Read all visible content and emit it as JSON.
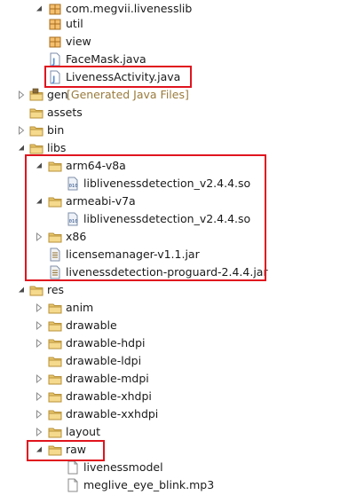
{
  "colors": {
    "highlight": "#e0141e",
    "decoration": "#9a7b3c",
    "folder": "#e8c66c",
    "java_file": "#5b8fd8"
  },
  "rows": [
    {
      "name": "tree-item-com-megvii-livenesslib",
      "label": "com.megvii.livenesslib",
      "arrow": "expanded",
      "icon": "package-icon",
      "interactable": true
    },
    {
      "name": "tree-item-util",
      "label": "util",
      "arrow": "collapsed",
      "icon": "package-icon",
      "interactable": true
    },
    {
      "name": "tree-item-view",
      "label": "view",
      "arrow": "collapsed",
      "icon": "package-icon",
      "interactable": true
    },
    {
      "name": "tree-item-facemask-java",
      "label": "FaceMask.java",
      "arrow": "collapsed",
      "icon": "java-file-icon",
      "interactable": true
    },
    {
      "name": "tree-item-livenessactivity-java",
      "label": "LivenessActivity.java",
      "arrow": "collapsed",
      "icon": "java-file-icon",
      "interactable": true
    },
    {
      "name": "tree-item-gen",
      "label": "gen",
      "decoration": "[Generated Java Files]",
      "arrow": "collapsed",
      "icon": "source-folder-icon",
      "interactable": true
    },
    {
      "name": "tree-item-assets",
      "label": "assets",
      "arrow": "none",
      "icon": "folder-icon",
      "interactable": true
    },
    {
      "name": "tree-item-bin",
      "label": "bin",
      "arrow": "collapsed",
      "icon": "folder-icon",
      "interactable": true
    },
    {
      "name": "tree-item-libs",
      "label": "libs",
      "arrow": "expanded",
      "icon": "folder-icon",
      "interactable": true
    },
    {
      "name": "tree-item-arm64-v8a",
      "label": "arm64-v8a",
      "arrow": "expanded",
      "icon": "folder-icon",
      "interactable": true
    },
    {
      "name": "tree-item-so-arm64",
      "label": "libliveness­detection_v2.4.4.so",
      "arrow": "none",
      "icon": "binary-file-icon",
      "interactable": true
    },
    {
      "name": "tree-item-armeabi-v7a",
      "label": "armeabi-v7a",
      "arrow": "expanded",
      "icon": "folder-icon",
      "interactable": true
    },
    {
      "name": "tree-item-so-armeabi",
      "label": "libliveness­detection_v2.4.4.so",
      "arrow": "none",
      "icon": "binary-file-icon",
      "interactable": true
    },
    {
      "name": "tree-item-x86",
      "label": "x86",
      "arrow": "collapsed",
      "icon": "folder-icon",
      "interactable": true
    },
    {
      "name": "tree-item-licensemanager-jar",
      "label": "licensemanager-v1.1.jar",
      "arrow": "none",
      "icon": "jar-icon",
      "interactable": true
    },
    {
      "name": "tree-item-proguard-jar",
      "label": "livenessdetection-proguard-2.4.4.jar",
      "arrow": "none",
      "icon": "jar-icon",
      "interactable": true
    },
    {
      "name": "tree-item-res",
      "label": "res",
      "arrow": "expanded",
      "icon": "folder-icon",
      "interactable": true
    },
    {
      "name": "tree-item-anim",
      "label": "anim",
      "arrow": "collapsed",
      "icon": "folder-icon",
      "interactable": true
    },
    {
      "name": "tree-item-drawable",
      "label": "drawable",
      "arrow": "collapsed",
      "icon": "folder-icon",
      "interactable": true
    },
    {
      "name": "tree-item-drawable-hdpi",
      "label": "drawable-hdpi",
      "arrow": "collapsed",
      "icon": "folder-icon",
      "interactable": true
    },
    {
      "name": "tree-item-drawable-ldpi",
      "label": "drawable-ldpi",
      "arrow": "none",
      "icon": "folder-icon",
      "interactable": true
    },
    {
      "name": "tree-item-drawable-mdpi",
      "label": "drawable-mdpi",
      "arrow": "collapsed",
      "icon": "folder-icon",
      "interactable": true
    },
    {
      "name": "tree-item-drawable-xhdpi",
      "label": "drawable-xhdpi",
      "arrow": "collapsed",
      "icon": "folder-icon",
      "interactable": true
    },
    {
      "name": "tree-item-drawable-xxhdpi",
      "label": "drawable-xxhdpi",
      "arrow": "collapsed",
      "icon": "folder-icon",
      "interactable": true
    },
    {
      "name": "tree-item-layout",
      "label": "layout",
      "arrow": "collapsed",
      "icon": "folder-icon",
      "interactable": true
    },
    {
      "name": "tree-item-raw",
      "label": "raw",
      "arrow": "expanded",
      "icon": "folder-icon",
      "interactable": true
    },
    {
      "name": "tree-item-livenessmodel",
      "label": "livenessmodel",
      "arrow": "none",
      "icon": "file-icon",
      "interactable": true
    },
    {
      "name": "tree-item-meglive-eye-blink-mp3",
      "label": "meglive_eye_blink.mp3",
      "arrow": "none",
      "icon": "file-icon",
      "interactable": true
    }
  ],
  "highlights": [
    {
      "name": "highlight-livenessactivity"
    },
    {
      "name": "highlight-libs-contents"
    },
    {
      "name": "highlight-raw"
    }
  ]
}
